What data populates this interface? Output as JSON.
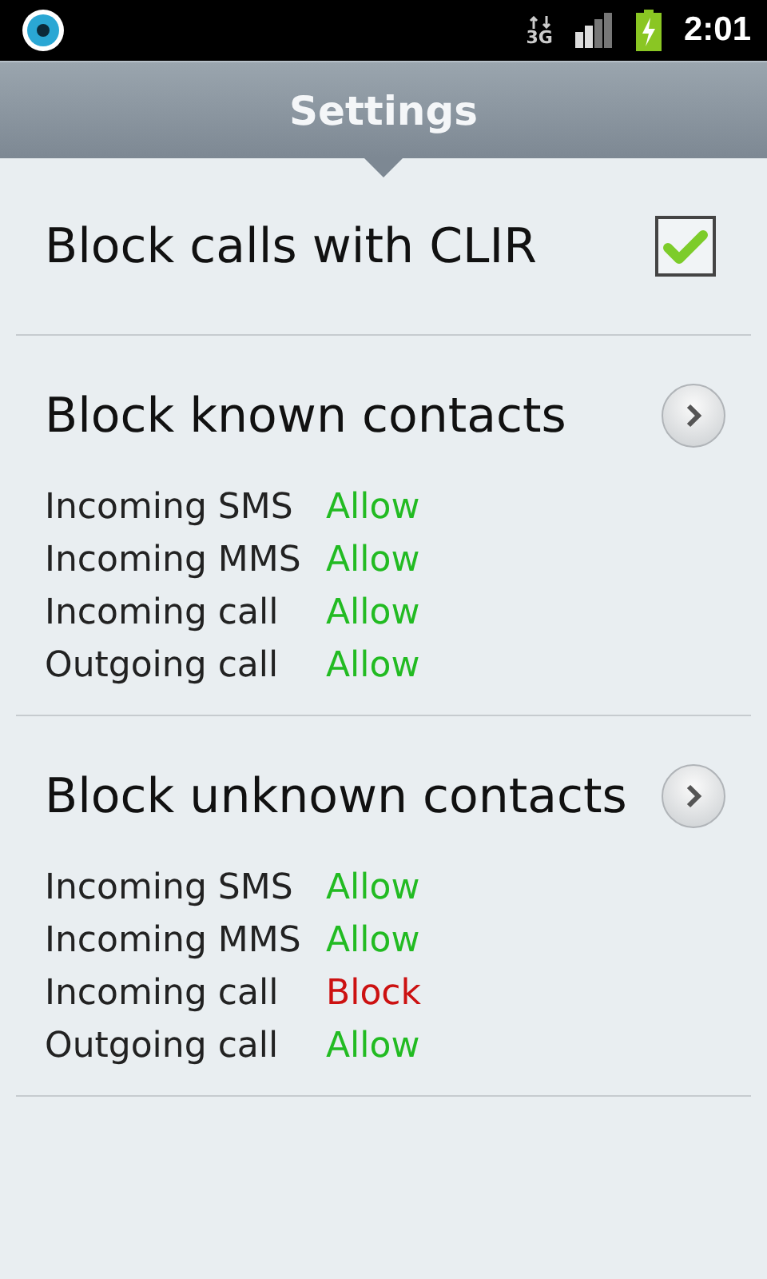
{
  "status_bar": {
    "network": "3G",
    "time": "2:01"
  },
  "header": {
    "title": "Settings"
  },
  "clir": {
    "label": "Block calls with CLIR",
    "checked": true
  },
  "sections": [
    {
      "title": "Block known contacts",
      "rules": [
        {
          "label": "Incoming SMS",
          "value": "Allow",
          "color": "#22bb22"
        },
        {
          "label": "Incoming MMS",
          "value": "Allow",
          "color": "#22bb22"
        },
        {
          "label": "Incoming call",
          "value": "Allow",
          "color": "#22bb22"
        },
        {
          "label": "Outgoing call",
          "value": "Allow",
          "color": "#22bb22"
        }
      ]
    },
    {
      "title": "Block unknown contacts",
      "rules": [
        {
          "label": "Incoming SMS",
          "value": "Allow",
          "color": "#22bb22"
        },
        {
          "label": "Incoming MMS",
          "value": "Allow",
          "color": "#22bb22"
        },
        {
          "label": "Incoming call",
          "value": "Block",
          "color": "#cc1111"
        },
        {
          "label": "Outgoing call",
          "value": "Allow",
          "color": "#22bb22"
        }
      ]
    }
  ]
}
